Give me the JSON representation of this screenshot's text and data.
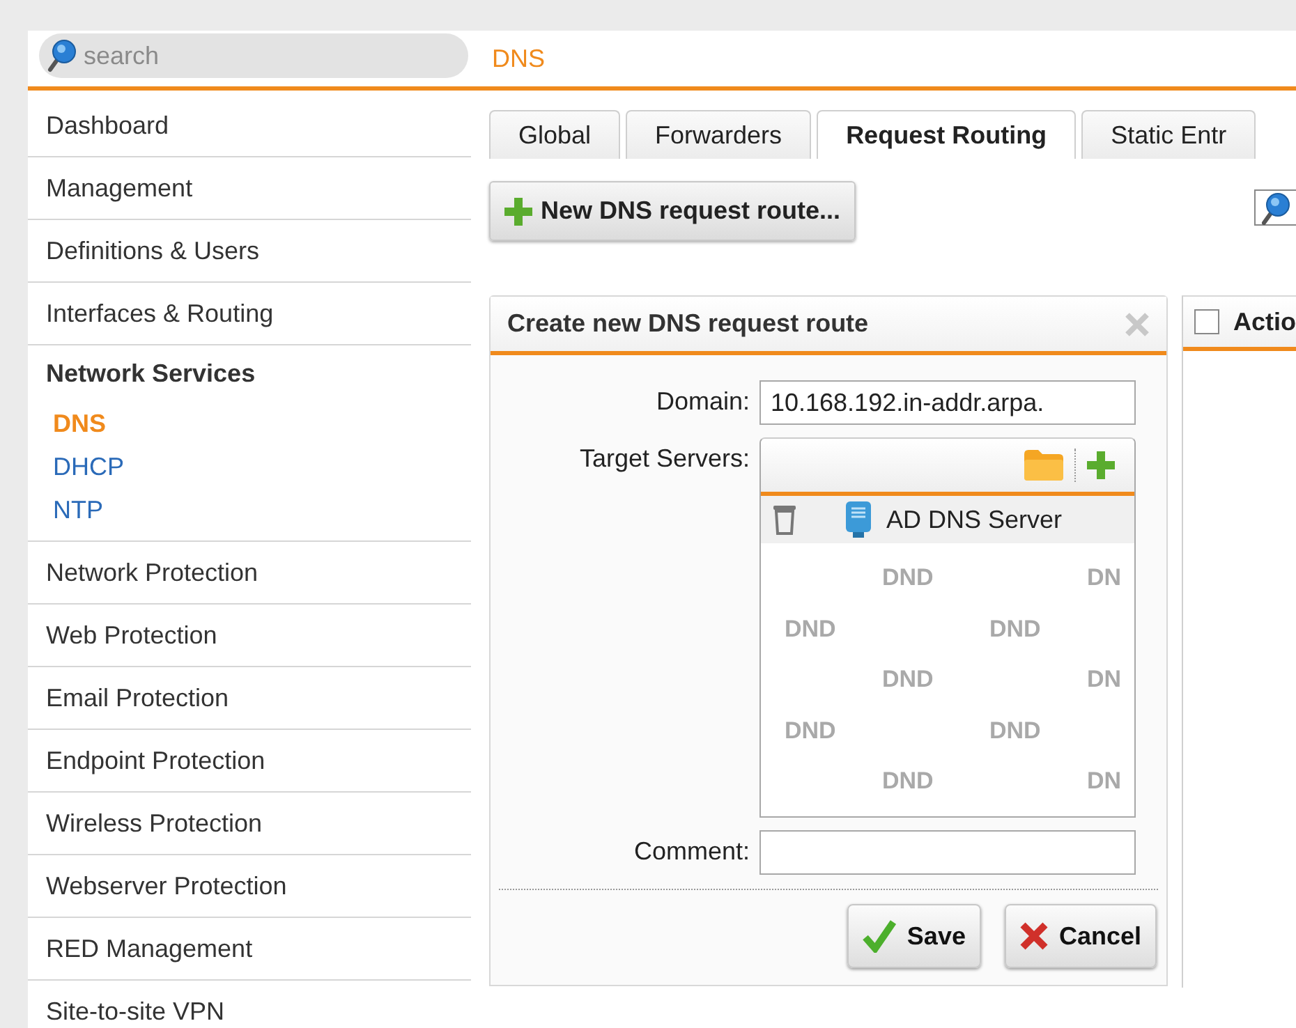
{
  "search": {
    "placeholder": "search"
  },
  "sidebar": {
    "items": [
      {
        "label": "Dashboard",
        "kind": "item"
      },
      {
        "label": "Management",
        "kind": "item"
      },
      {
        "label": "Definitions & Users",
        "kind": "item"
      },
      {
        "label": "Interfaces & Routing",
        "kind": "item"
      },
      {
        "label": "Network Services",
        "kind": "group",
        "children": [
          {
            "label": "DNS",
            "selected": true
          },
          {
            "label": "DHCP",
            "selected": false
          },
          {
            "label": "NTP",
            "selected": false
          }
        ]
      },
      {
        "label": "Network Protection",
        "kind": "item"
      },
      {
        "label": "Web Protection",
        "kind": "item"
      },
      {
        "label": "Email Protection",
        "kind": "item"
      },
      {
        "label": "Endpoint Protection",
        "kind": "item"
      },
      {
        "label": "Wireless Protection",
        "kind": "item"
      },
      {
        "label": "Webserver Protection",
        "kind": "item"
      },
      {
        "label": "RED Management",
        "kind": "item"
      },
      {
        "label": "Site-to-site VPN",
        "kind": "item"
      }
    ]
  },
  "page_title": "DNS",
  "tabs": [
    {
      "label": "Global",
      "selected": false
    },
    {
      "label": "Forwarders",
      "selected": false
    },
    {
      "label": "Request Routing",
      "selected": true
    },
    {
      "label": "Static Entr",
      "selected": false
    }
  ],
  "toolbar": {
    "new_button": "New DNS request route..."
  },
  "dialog": {
    "title": "Create new DNS request route",
    "fields": [
      {
        "kind": "text",
        "label": "Domain:",
        "value": "10.168.192.in-addr.arpa."
      },
      {
        "kind": "list",
        "label": "Target Servers:",
        "items": [
          {
            "label": "AD DNS Server"
          }
        ],
        "drop_hint": [
          [
            "DND",
            "DN"
          ],
          [
            "DND",
            "DND"
          ],
          [
            "DND",
            "DN"
          ],
          [
            "DND",
            "DND"
          ],
          [
            "DND",
            "DN"
          ]
        ]
      },
      {
        "kind": "text",
        "label": "Comment:"
      }
    ],
    "buttons": [
      {
        "kind": "save",
        "label": "Save"
      },
      {
        "kind": "cancel",
        "label": "Cancel"
      }
    ]
  },
  "list_panel": {
    "header": "Actio",
    "checked": false
  }
}
